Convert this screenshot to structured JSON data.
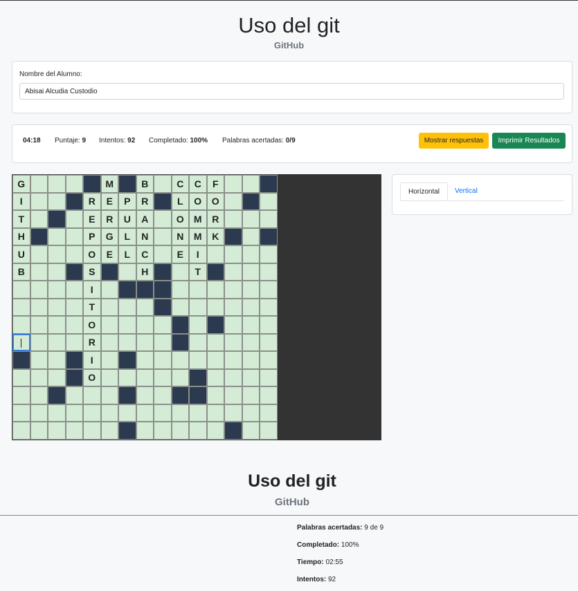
{
  "header": {
    "title": "Uso del git",
    "subtitle": "GitHub"
  },
  "student": {
    "label": "Nombre del Alumno:",
    "value": "Abisai Alcudia Custodio"
  },
  "stats": {
    "time": "04:18",
    "score_label": "Puntaje:",
    "score": "9",
    "attempts_label": "Intentos:",
    "attempts": "92",
    "completed_label": "Completado:",
    "completed": "100%",
    "words_label": "Palabras acertadas:",
    "words": "0/9"
  },
  "buttons": {
    "show_answers": "Mostrar respuestas",
    "print_results": "Imprimir Resultados"
  },
  "board": {
    "rows": [
      "G___#M#B_CCF__#",
      "I__#REPR#LOO_#_",
      "T_#_ERUA_OMR___",
      "H#__PGLN_NMK#_#",
      "U___OELC_EI____",
      "B__#S#_H#_T#___",
      "____I_###______",
      "____T___#______",
      "____O____#_#___",
      "____R____#_____",
      "#__#I_#________",
      "___#O_____#____",
      "__#___#__##____",
      "_______________",
      "______#_____#__"
    ],
    "selected_cell": [
      9,
      0
    ]
  },
  "tabs": {
    "horizontal": "Horizontal",
    "vertical": "Vertical"
  },
  "results": {
    "title": "Uso del git",
    "subtitle": "GitHub",
    "words_label": "Palabras acertadas:",
    "words": "9 de 9",
    "completed_label": "Completado:",
    "completed": "100%",
    "time_label": "Tiempo:",
    "time": "02:55",
    "attempts_label": "Intentos:",
    "attempts": "92"
  }
}
